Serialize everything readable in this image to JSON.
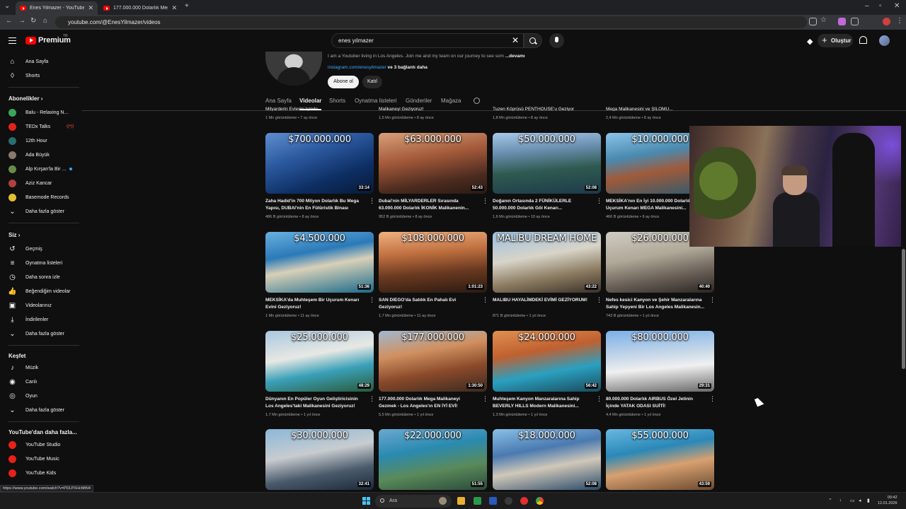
{
  "browser": {
    "tabs": [
      {
        "title": "Enes Yilmazer - YouTube",
        "active": true
      },
      {
        "title": "177.000.000 Dolarlık Mega Mal",
        "active": false
      }
    ],
    "url": "youtube.com/@EnesYilmazer/videos"
  },
  "topbar": {
    "logo_text": "Premium",
    "logo_region": "TR",
    "search_value": "enes yılmazer",
    "create_label": "Oluştur"
  },
  "sidebar": {
    "main": [
      {
        "label": "Ana Sayfa",
        "icon": "home-icon"
      },
      {
        "label": "Shorts",
        "icon": "shorts-icon"
      }
    ],
    "subscriptions_header": "Abonelikler",
    "subscriptions": [
      {
        "label": "Balu - Relaxing N...",
        "color": "#3aa55a"
      },
      {
        "label": "TEDx Talks",
        "color": "#e62117",
        "live": true
      },
      {
        "label": "12th Hour",
        "color": "#2a6e6e"
      },
      {
        "label": "Ada Büyük",
        "color": "#8a7a6a"
      },
      {
        "label": "Alp Kırşan'la Bir ...",
        "color": "#6a8a4a",
        "dot": true
      },
      {
        "label": "Aziz Kancar",
        "color": "#b04040"
      },
      {
        "label": "Basemode Records",
        "color": "#e0c030"
      }
    ],
    "subs_more": "Daha fazla göster",
    "you_header": "Siz",
    "you": [
      {
        "label": "Geçmiş",
        "icon": "history-icon"
      },
      {
        "label": "Oynatma listeleri",
        "icon": "playlists-icon"
      },
      {
        "label": "Daha sonra izle",
        "icon": "watch-later-icon"
      },
      {
        "label": "Beğendiğim videolar",
        "icon": "like-icon"
      },
      {
        "label": "Videolarınız",
        "icon": "your-videos-icon"
      },
      {
        "label": "İndirilenler",
        "icon": "download-icon"
      }
    ],
    "you_more": "Daha fazla göster",
    "explore_header": "Keşfet",
    "explore": [
      {
        "label": "Müzik",
        "icon": "music-icon"
      },
      {
        "label": "Canlı",
        "icon": "live-icon"
      },
      {
        "label": "Oyun",
        "icon": "gaming-icon"
      }
    ],
    "explore_more": "Daha fazla göster",
    "more_header": "YouTube'dan daha fazla...",
    "more": [
      {
        "label": "YouTube Studio"
      },
      {
        "label": "YouTube Music"
      },
      {
        "label": "YouTube Kids"
      }
    ]
  },
  "channel": {
    "description": "I am a Youtuber living in Los Angeles. Join me and my team on our journey to see som",
    "more": "...devamı",
    "link": "instagram.com/enesyilmazer",
    "links_more": "ve 3 bağlantı daha",
    "subscribe": "Abone ol",
    "join": "Katıl",
    "tabs": [
      "Ana Sayfa",
      "Videolar",
      "Shorts",
      "Oynatma listeleri",
      "Gönderiler",
      "Mağaza"
    ],
    "active_tab": "Videolar"
  },
  "partial_row": [
    {
      "title": "Milyarderin Evlerini İçinde",
      "meta": "1 Mn görüntüleme • 7 ay önce"
    },
    {
      "title": "Malikaneyi Geziyoruz!",
      "meta": "1,5 Mn görüntüleme • 8 ay önce"
    },
    {
      "title": "Tuzen Köprüsü PENTHOUSE'u Geziyor",
      "meta": "1,8 Mn görüntüleme • 8 ay önce"
    },
    {
      "title": "Mega Malikanesini ve ŞİLOMU...",
      "meta": "2,4 Mn görüntüleme • 8 ay önce"
    }
  ],
  "videos": [
    {
      "price": "$700.000.000",
      "duration": "33:14",
      "title": "Zaha Hadid'in 700 Milyon Dolarlık Bu Mega Yapısı, DUBAI'nin En Fütüristik Binası",
      "meta": "486 B görüntüleme • 8 ay önce",
      "bg": "linear-gradient(160deg,#5e8fd0 0%,#2c5aa0 35%,#0d2e63 70%,#091a38 100%)"
    },
    {
      "price": "$63.000.000",
      "duration": "52:43",
      "title": "Dubai'nin MİLYARDERLER Sırasında 63.000.000 Dolarlık İKONİK Malikanenin...",
      "meta": "952 B görüntüleme • 8 ay önce",
      "bg": "linear-gradient(170deg,#d9a07a 0%,#a35a3a 40%,#4c2b1f 75%,#2a1a14 100%)"
    },
    {
      "price": "$50.000.000",
      "duration": "52:08",
      "title": "Doğanın Ortasında 2 FÜNİKÜLERLE 50.000.000 Dolarlık Göl Kenarı...",
      "meta": "1,6 Mn görüntüleme • 10 ay önce",
      "bg": "linear-gradient(175deg,#a8c8e8 0%,#6a8fb0 30%,#2f5a50 60%,#1d3a4a 100%)"
    },
    {
      "price": "$10.000.000",
      "duration": "",
      "title": "MEKSİKA'nın En İyi 10.000.000 Dolarlık Uçurum Kenarı MEGA Malikanesini...",
      "meta": "466 B görüntüleme • 9 ay önce",
      "bg": "linear-gradient(170deg,#8cc4e8 0%,#4a8ab0 35%,#a05a3a 60%,#2a5a70 100%)"
    },
    {
      "price": "$4.500.000",
      "duration": "51:36",
      "title": "MEKSİKA'da Muhteşem Bir Uçurum Kenarı Evini Geziyoruz!",
      "meta": "1 Mn görüntüleme • 11 ay önce",
      "bg": "linear-gradient(170deg,#6ab0e0 0%,#2a7ab8 35%,#d8d0b8 55%,#1a6a8a 100%)"
    },
    {
      "price": "$108.000.000",
      "duration": "1:01:23",
      "title": "SAN DIEGO'da Satılık En Pahalı Evi Geziyoruz!",
      "meta": "1,7 Mn görüntüleme • 11 ay önce",
      "bg": "linear-gradient(175deg,#f0b080 0%,#c07040 35%,#6a3a20 65%,#2a1a10 100%)"
    },
    {
      "price": "MALIBU DREAM HOME",
      "duration": "43:22",
      "title": "MALIBU HAYALİMDEKİ EVİMİ GEZİYORUM!",
      "meta": "871 B görüntüleme • 1 yıl önce",
      "bg": "linear-gradient(170deg,#9ac0e0 0%,#d8d4c8 40%,#8a7a60 70%,#3a3028 100%)"
    },
    {
      "price": "$26.000.000",
      "duration": "40:40",
      "title": "Nefes kesici Kanyon ve Şehir Manzaralarına Sahip Yepyeni Bir Los Angeles Malikanesin...",
      "meta": "743 B görüntüleme • 1 yıl önce",
      "bg": "linear-gradient(170deg,#d0ccc4 0%,#b0a898 40%,#6a6058 70%,#2a2620 100%)"
    },
    {
      "price": "$25.000.000",
      "duration": "48:29",
      "title": "Dünyanın En Popüler Oyun Geliştiricisinin Los Angeles'taki Malikanesini Geziyoruz!",
      "meta": "1,7 Mn görüntüleme • 1 yıl önce",
      "bg": "linear-gradient(170deg,#a8c8e0 0%,#e8e8e4 40%,#3aa0b8 65%,#2a5a3a 100%)"
    },
    {
      "price": "$177.000.000",
      "duration": "1:30:50",
      "title": "177.000.000 Dolarlık Mega Malikaneyi Gezmek - Los Angeles'ın EN İYİ EVİ!",
      "meta": "5,5 Mn görüntüleme • 1 yıl önce",
      "bg": "linear-gradient(170deg,#a0b8d0 0%,#d09060 35%,#8a4a2a 65%,#3a2a20 100%)"
    },
    {
      "price": "$24.000.000",
      "duration": "56:42",
      "title": "Muhteşem Kanyon Manzaralarına Sahip BEVERLY HILLS Modern Malikanesini...",
      "meta": "1,3 Mn görüntüleme • 1 yıl önce",
      "bg": "linear-gradient(170deg,#e09050 0%,#c06030 35%,#2aa0c0 65%,#1a4a5a 100%)"
    },
    {
      "price": "$80.000.000",
      "duration": "29:31",
      "title": "80.000.000 Dolarlık AIRBUS Özel Jetinin İçinde YATAK ODASI SUİTİ!",
      "meta": "4,4 Mn görüntüleme • 1 yıl önce",
      "bg": "linear-gradient(175deg,#7ab0e8 0%,#c8d8e8 40%,#f0f0f0 60%,#6a6a6a 100%)"
    },
    {
      "price": "$30.000.000",
      "duration": "32:41",
      "title": "",
      "meta": "",
      "bg": "linear-gradient(170deg,#8ab8d8 0%,#c8ccd0 40%,#4a5a6a 70%,#1a2a3a 100%)"
    },
    {
      "price": "$22.000.000",
      "duration": "51:55",
      "title": "",
      "meta": "",
      "bg": "linear-gradient(170deg,#6aa8d0 0%,#2a8ab0 35%,#5a8a5a 65%,#2a4a3a 100%)"
    },
    {
      "price": "$18.000.000",
      "duration": "52:08",
      "title": "",
      "meta": "",
      "bg": "linear-gradient(170deg,#8ac0e8 0%,#4a7ab0 35%,#d0c8b8 60%,#2a4a6a 100%)"
    },
    {
      "price": "$55.000.000",
      "duration": "43:59",
      "title": "",
      "meta": "",
      "bg": "linear-gradient(170deg,#6ab8e0 0%,#2a88b8 35%,#d8a070 60%,#6a4a30 100%)"
    }
  ],
  "status_url": "https://www.youtube.com/watch?v=PDLPXHcMtN4",
  "taskbar": {
    "search_label": "Ara",
    "time": "00:42",
    "date": "12.01.2026"
  }
}
